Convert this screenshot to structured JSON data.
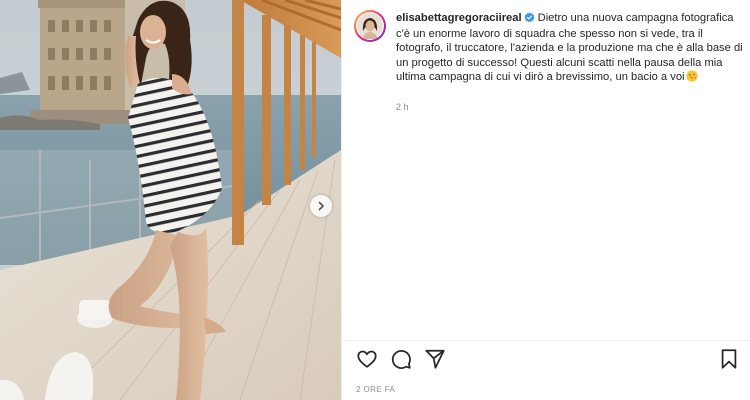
{
  "post": {
    "username": "elisabettagregoraciireal",
    "caption": "Dietro una nuova campagna fotografica c'è un enorme lavoro di squadra che spesso non si vede, tra il fotografo, il truccatore, l'azienda e la produzione ma che è alla base di un progetto di successo! Questi alcuni scatti nella pausa della mia ultima campagna di cui vi dirò a brevissimo, un bacio a voi",
    "time_ago": "2 h",
    "date_label": "2 ORE FA"
  },
  "icons": {
    "verified": "verified-badge-icon",
    "emoji": "kissing-face-emoji-icon",
    "like": "heart-icon",
    "comment": "comment-bubble-icon",
    "share": "paper-plane-icon",
    "save": "bookmark-icon",
    "next": "chevron-right-icon"
  },
  "colors": {
    "verified_blue": "#3897f0",
    "text_primary": "#262626",
    "text_secondary": "#8e8e8e",
    "divider": "#efefef"
  }
}
